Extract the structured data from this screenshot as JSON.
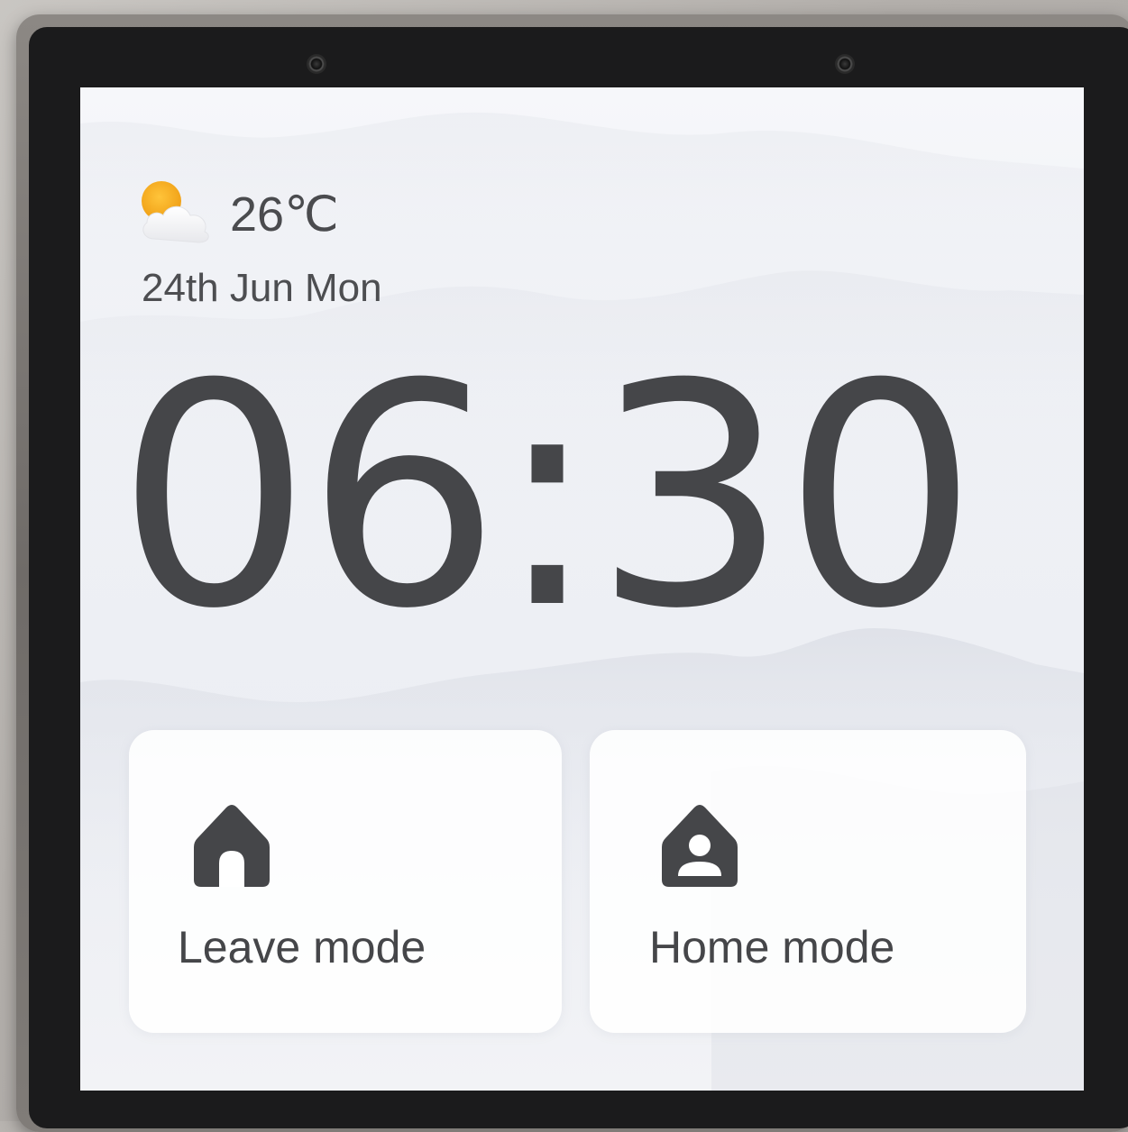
{
  "weather": {
    "icon": "partly-cloudy-icon",
    "temperature": "26℃"
  },
  "date": "24th Jun Mon",
  "clock": {
    "time": "06:30"
  },
  "modes": [
    {
      "label": "Leave mode",
      "icon": "house-icon"
    },
    {
      "label": "Home mode",
      "icon": "house-person-icon"
    }
  ],
  "colors": {
    "text": "#454649",
    "sun": "#f4a81c",
    "card": "#ffffff",
    "bezel": "#1b1b1c"
  }
}
